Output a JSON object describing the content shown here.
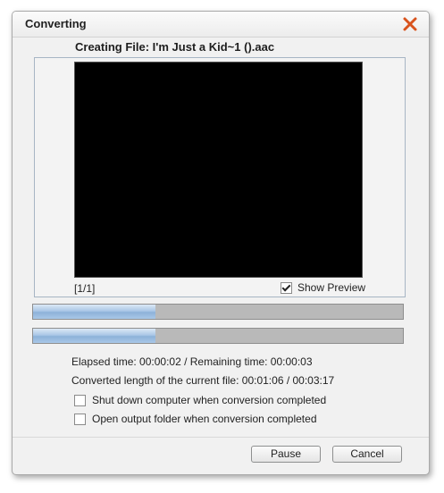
{
  "window": {
    "title": "Converting"
  },
  "file": {
    "creating_label": "Creating File: I'm Just a Kid~1 ().aac"
  },
  "preview": {
    "counter": "[1/1]",
    "show_preview_label": "Show Preview",
    "show_preview_checked": true
  },
  "progress": {
    "file_progress": 0.33,
    "total_progress": 0.33
  },
  "info": {
    "elapsed_line": "Elapsed time:  00:00:02 / Remaining time:  00:00:03",
    "converted_line": "Converted length of the current file:  00:01:06 / 00:03:17"
  },
  "options": {
    "shutdown_label": "Shut down computer when conversion completed",
    "shutdown_checked": false,
    "open_folder_label": "Open output folder when conversion completed",
    "open_folder_checked": false
  },
  "buttons": {
    "pause_label": "Pause",
    "cancel_label": "Cancel"
  },
  "colors": {
    "close_icon": "#d9541e",
    "progress_fill": "#9dbde2",
    "progress_track": "#b9b9b9"
  },
  "icons": {
    "close": "close-icon"
  }
}
